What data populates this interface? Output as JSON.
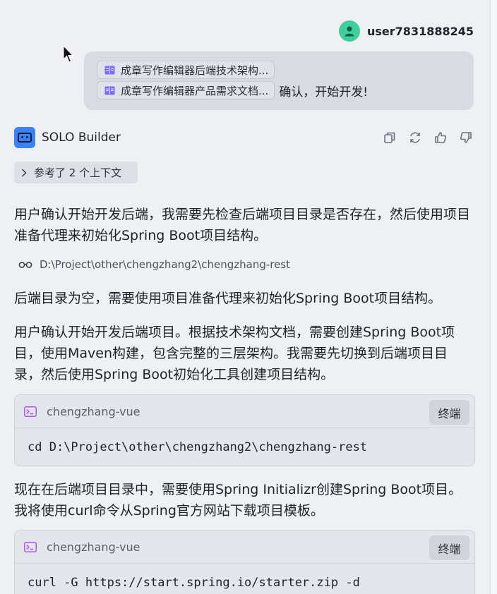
{
  "user": {
    "name": "user7831888245",
    "avatar_icon": "user-icon",
    "avatar_color": "#3fcf9f"
  },
  "user_message": {
    "references": [
      {
        "icon": "doc-icon",
        "label": "成章写作编辑器后端技术架构..."
      },
      {
        "icon": "doc-icon",
        "label": "成章写作编辑器产品需求文档..."
      }
    ],
    "text": "确认，开始开发!"
  },
  "assistant": {
    "name": "SOLO Builder",
    "avatar_color": "#3b82f6",
    "actions": [
      "copy-icon",
      "refresh-icon",
      "thumbs-up-icon",
      "thumbs-down-icon"
    ],
    "context_label": "参考了 2 个上下文",
    "paragraphs": [
      "用户确认开始开发后端，我需要先检查后端项目目录是否存在，然后使用项目准备代理来初始化Spring Boot项目结构。",
      "后端目录为空，需要使用项目准备代理来初始化Spring Boot项目结构。",
      "用户确认开始开发后端项目。根据技术架构文档，需要创建Spring Boot项目，使用Maven构建，包含完整的三层架构。我需要先切换到后端项目目录，然后使用Spring Boot初始化工具创建项目结构。",
      "现在在后端项目目录中，需要使用Spring Initializr创建Spring Boot项目。我将使用curl命令从Spring官方网站下载项目模板。"
    ],
    "viewed_path": "D:\\Project\\other\\chengzhang2\\chengzhang-rest",
    "code_blocks": [
      {
        "cwd": "chengzhang-vue",
        "button": "终端",
        "command": "cd D:\\Project\\other\\chengzhang2\\chengzhang-rest"
      },
      {
        "cwd": "chengzhang-vue",
        "button": "终端",
        "command": "curl -G https://start.spring.io/starter.zip -d"
      }
    ]
  }
}
